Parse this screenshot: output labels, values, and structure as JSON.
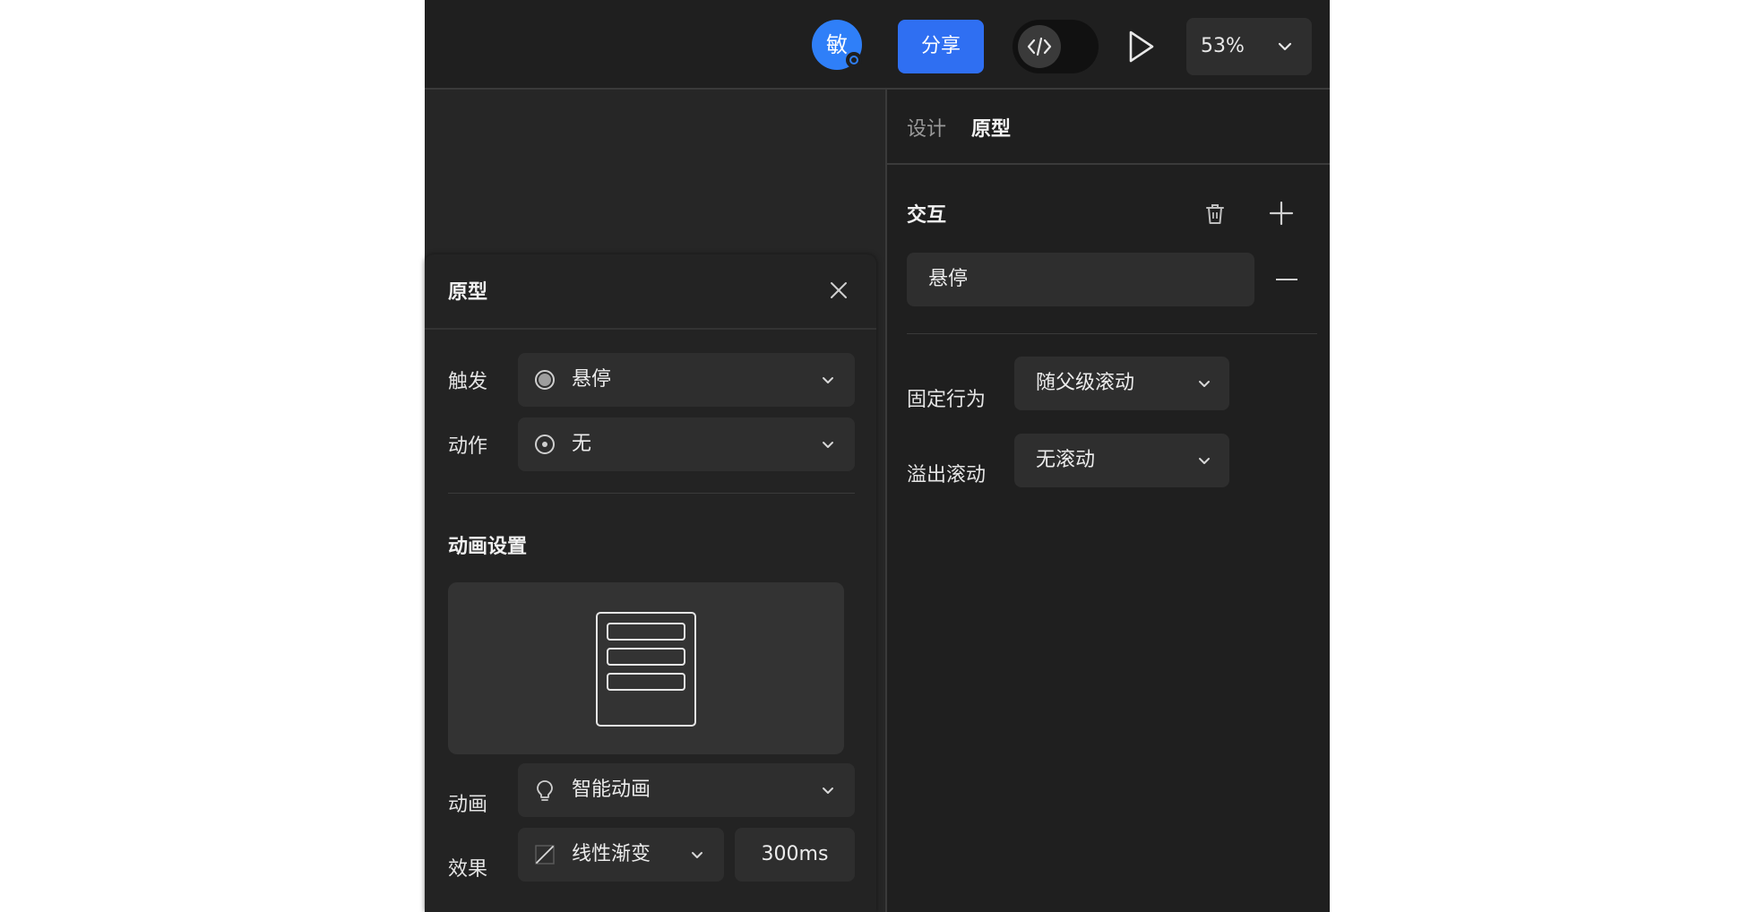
{
  "topbar": {
    "avatar_initial": "敏",
    "share_label": "分享",
    "zoom_level": "53%"
  },
  "right_panel": {
    "tabs": [
      {
        "label": "设计",
        "active": false
      },
      {
        "label": "原型",
        "active": true
      }
    ],
    "section_title": "交互",
    "interaction": "悬停",
    "properties": [
      {
        "label": "固定行为",
        "value": "随父级滚动"
      },
      {
        "label": "溢出滚动",
        "value": "无滚动"
      }
    ]
  },
  "prototype_panel": {
    "title": "原型",
    "trigger_label": "触发",
    "trigger_value": "悬停",
    "action_label": "动作",
    "action_value": "无",
    "animation_section": "动画设置",
    "animation_label": "动画",
    "animation_value": "智能动画",
    "effect_label": "效果",
    "effect_value": "线性渐变",
    "duration": "300ms"
  },
  "colors": {
    "accent_blue": "#2f6ff2",
    "background": "#1f1f1f",
    "panel": "#232323",
    "control": "#2e2e2e"
  },
  "icons": [
    "code-icon",
    "play-icon",
    "chevron-down-icon",
    "trash-icon",
    "plus-icon",
    "minus-icon",
    "close-icon",
    "hover-trigger-icon",
    "radio-icon",
    "bulb-icon",
    "linear-curve-icon",
    "scroll-preview-icon"
  ]
}
